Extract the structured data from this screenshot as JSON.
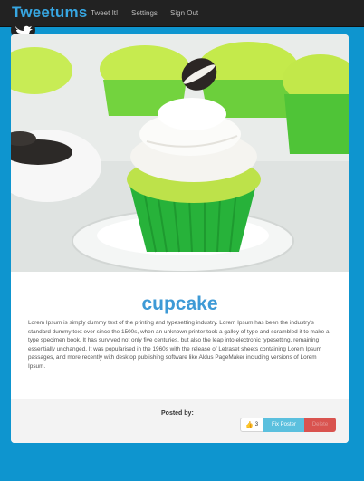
{
  "navbar": {
    "brand": "Tweetums",
    "links": [
      "Tweet It!",
      "Settings",
      "Sign Out"
    ]
  },
  "post": {
    "title": "cupcake",
    "description": "Lorem Ipsum is simply dummy text of the printing and typesetting industry. Lorem Ipsum has been the industry's standard dummy text ever since the 1500s, when an unknown printer took a galley of type and scrambled it to make a type specimen book. It has survived not only five centuries, but also the leap into electronic typesetting, remaining essentially unchanged. It was popularised in the 1960s with the release of Letraset sheets containing Lorem Ipsum passages, and more recently with desktop publishing software like Aldus PageMaker including versions of Lorem Ipsum.",
    "posted_by_label": "Posted by:",
    "like_count": "3",
    "fix_label": "Fix Poster",
    "delete_label": "Delete"
  },
  "icons": {
    "logo": "twitter-bird-icon",
    "like": "thumbs-up-icon"
  },
  "colors": {
    "page_bg": "#0e95cf",
    "navbar_bg": "#222222",
    "brand": "#37a7e3",
    "title": "#3e9ad6",
    "fix_button": "#5bc0de",
    "delete_button": "#d9534f"
  }
}
